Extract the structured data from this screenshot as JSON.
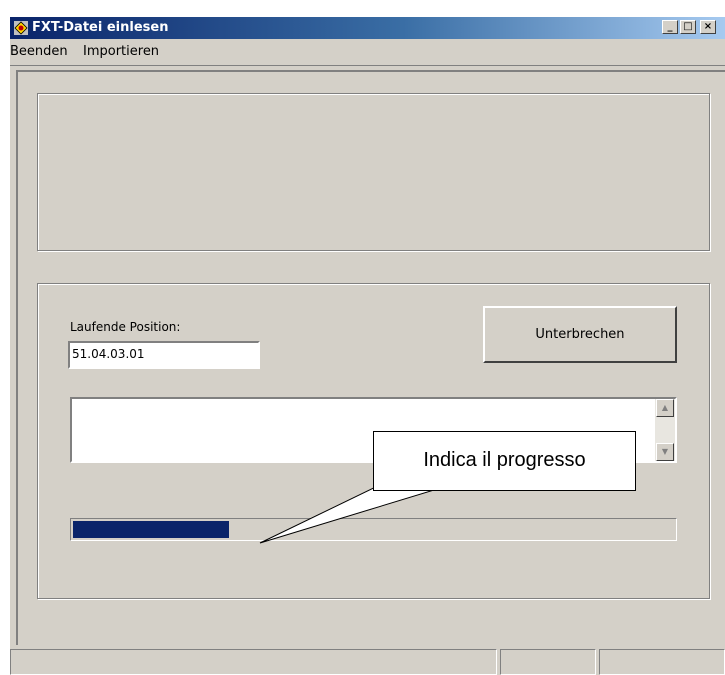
{
  "window": {
    "title": "FXT-Datei einlesen"
  },
  "menu": {
    "items": [
      "Beenden",
      "Importieren"
    ]
  },
  "form": {
    "position_label": "Laufende Position:",
    "position_value": "51.04.03.01",
    "interrupt_button": "Unterbrechen"
  },
  "progress": {
    "fraction": 0.26
  },
  "callout": {
    "text": "Indica il progresso"
  },
  "colors": {
    "progress_fill": "#0a246a",
    "face": "#d4d0c8"
  }
}
